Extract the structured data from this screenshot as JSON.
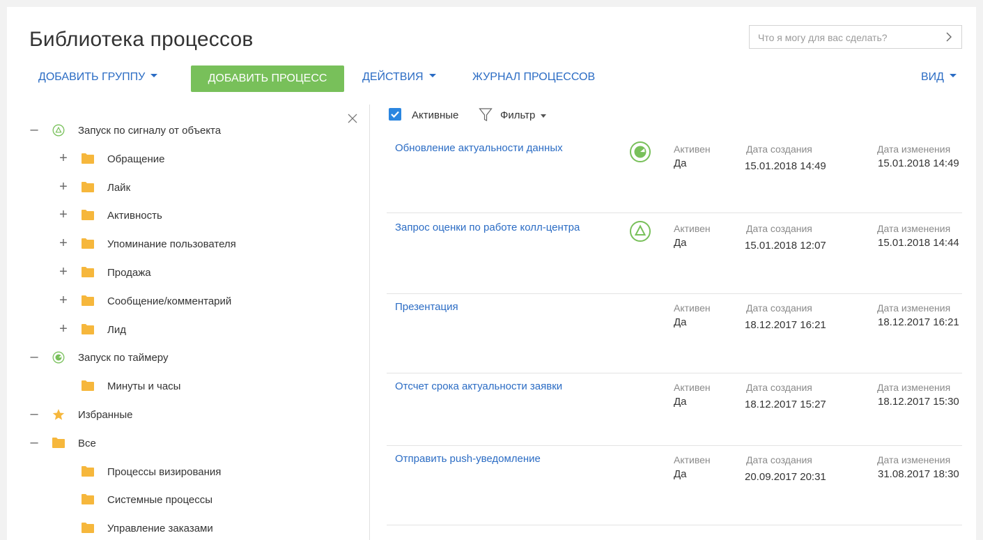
{
  "title": "Библиотека процессов",
  "command_input": {
    "placeholder": "Что я могу для вас сделать?"
  },
  "toolbar": {
    "add_group": "ДОБАВИТЬ ГРУППУ",
    "add_process": "ДОБАВИТЬ ПРОЦЕСС",
    "actions": "ДЕЙСТВИЯ",
    "process_log": "ЖУРНАЛ ПРОЦЕССОВ",
    "view": "ВИД"
  },
  "colors": {
    "accent_blue": "#2b6cc4",
    "green_button": "#78c05a",
    "folder_orange": "#f6b73c",
    "signal_green": "#78c05a",
    "checkbox_blue": "#2b86e0"
  },
  "tree": [
    {
      "toggle": "—",
      "icon": "signal-triangle-icon",
      "label": "Запуск по сигналу от объекта"
    },
    {
      "toggle": "+",
      "icon": "folder-icon",
      "label": "Обращение"
    },
    {
      "toggle": "+",
      "icon": "folder-icon",
      "label": "Лайк"
    },
    {
      "toggle": "+",
      "icon": "folder-icon",
      "label": "Активность"
    },
    {
      "toggle": "+",
      "icon": "folder-icon",
      "label": "Упоминание пользователя"
    },
    {
      "toggle": "+",
      "icon": "folder-icon",
      "label": "Продажа"
    },
    {
      "toggle": "+",
      "icon": "folder-icon",
      "label": "Сообщение/комментарий"
    },
    {
      "toggle": "+",
      "icon": "folder-icon",
      "label": "Лид"
    },
    {
      "toggle": "—",
      "icon": "timer-icon",
      "label": "Запуск по таймеру"
    },
    {
      "toggle": "",
      "icon": "folder-icon",
      "label": "Минуты и часы"
    },
    {
      "toggle": "—",
      "icon": "star-icon",
      "label": "Избранные"
    },
    {
      "toggle": "—",
      "icon": "folder-icon",
      "label": "Все"
    },
    {
      "toggle": "",
      "icon": "folder-icon",
      "label": "Процессы визирования"
    },
    {
      "toggle": "",
      "icon": "folder-icon",
      "label": "Системные процессы"
    },
    {
      "toggle": "",
      "icon": "folder-icon",
      "label": "Управление заказами"
    }
  ],
  "filter": {
    "active_label": "Активные",
    "filter_label": "Фильтр",
    "active_checked": true
  },
  "columns": {
    "active": "Активен",
    "created": "Дата создания",
    "modified": "Дата изменения"
  },
  "processes": [
    {
      "name": "Обновление актуальности данных",
      "icon": "timer-icon",
      "active": "Да",
      "created": "15.01.2018 14:49",
      "modified": "15.01.2018 14:49"
    },
    {
      "name": "Запрос оценки по работе колл-центра",
      "icon": "signal-triangle-icon",
      "active": "Да",
      "created": "15.01.2018 12:07",
      "modified": "15.01.2018 14:44"
    },
    {
      "name": "Презентация",
      "icon": "",
      "active": "Да",
      "created": "18.12.2017 16:21",
      "modified": "18.12.2017 16:21"
    },
    {
      "name": "Отсчет срока актуальности заявки",
      "icon": "",
      "active": "Да",
      "created": "18.12.2017 15:27",
      "modified": "18.12.2017 15:30"
    },
    {
      "name": "Отправить push-уведомление",
      "icon": "",
      "active": "Да",
      "created": "20.09.2017 20:31",
      "modified": "31.08.2017 18:30"
    }
  ]
}
